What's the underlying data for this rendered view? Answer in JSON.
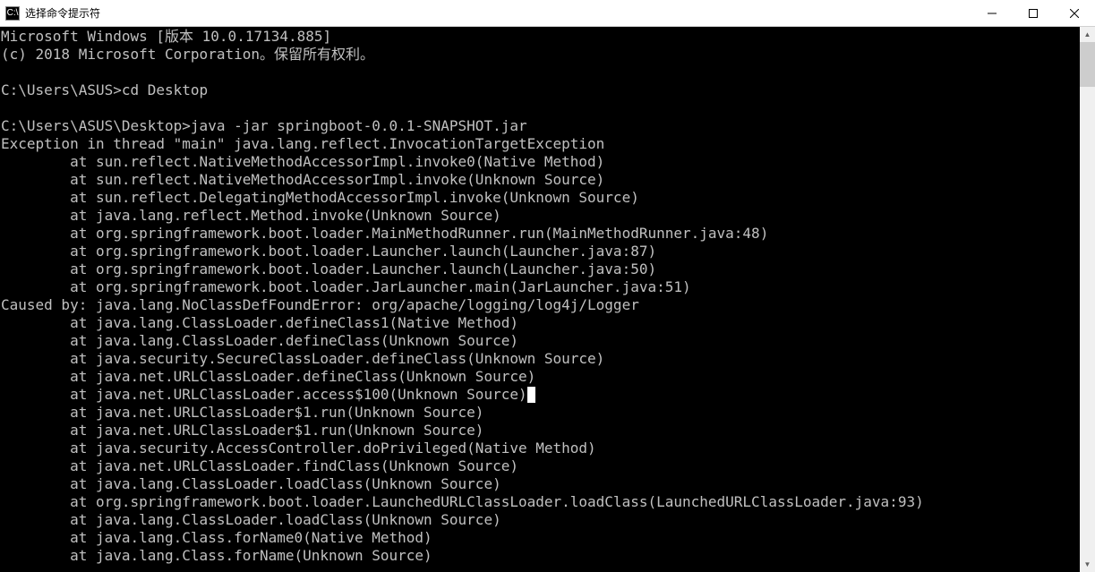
{
  "window": {
    "title": "选择命令提示符",
    "icon_label": "C:\\"
  },
  "terminal": {
    "lines": [
      "Microsoft Windows [版本 10.0.17134.885]",
      "(c) 2018 Microsoft Corporation。保留所有权利。",
      "",
      "C:\\Users\\ASUS>cd Desktop",
      "",
      "C:\\Users\\ASUS\\Desktop>java -jar springboot-0.0.1-SNAPSHOT.jar",
      "Exception in thread \"main\" java.lang.reflect.InvocationTargetException",
      "        at sun.reflect.NativeMethodAccessorImpl.invoke0(Native Method)",
      "        at sun.reflect.NativeMethodAccessorImpl.invoke(Unknown Source)",
      "        at sun.reflect.DelegatingMethodAccessorImpl.invoke(Unknown Source)",
      "        at java.lang.reflect.Method.invoke(Unknown Source)",
      "        at org.springframework.boot.loader.MainMethodRunner.run(MainMethodRunner.java:48)",
      "        at org.springframework.boot.loader.Launcher.launch(Launcher.java:87)",
      "        at org.springframework.boot.loader.Launcher.launch(Launcher.java:50)",
      "        at org.springframework.boot.loader.JarLauncher.main(JarLauncher.java:51)",
      "Caused by: java.lang.NoClassDefFoundError: org/apache/logging/log4j/Logger",
      "        at java.lang.ClassLoader.defineClass1(Native Method)",
      "        at java.lang.ClassLoader.defineClass(Unknown Source)",
      "        at java.security.SecureClassLoader.defineClass(Unknown Source)",
      "        at java.net.URLClassLoader.defineClass(Unknown Source)",
      "        at java.net.URLClassLoader.access$100(Unknown Source)",
      "        at java.net.URLClassLoader$1.run(Unknown Source)",
      "        at java.net.URLClassLoader$1.run(Unknown Source)",
      "        at java.security.AccessController.doPrivileged(Native Method)",
      "        at java.net.URLClassLoader.findClass(Unknown Source)",
      "        at java.lang.ClassLoader.loadClass(Unknown Source)",
      "        at org.springframework.boot.loader.LaunchedURLClassLoader.loadClass(LaunchedURLClassLoader.java:93)",
      "        at java.lang.ClassLoader.loadClass(Unknown Source)",
      "        at java.lang.Class.forName0(Native Method)",
      "        at java.lang.Class.forName(Unknown Source)"
    ],
    "cursor_column": 88,
    "cursor_line_index": 20
  }
}
